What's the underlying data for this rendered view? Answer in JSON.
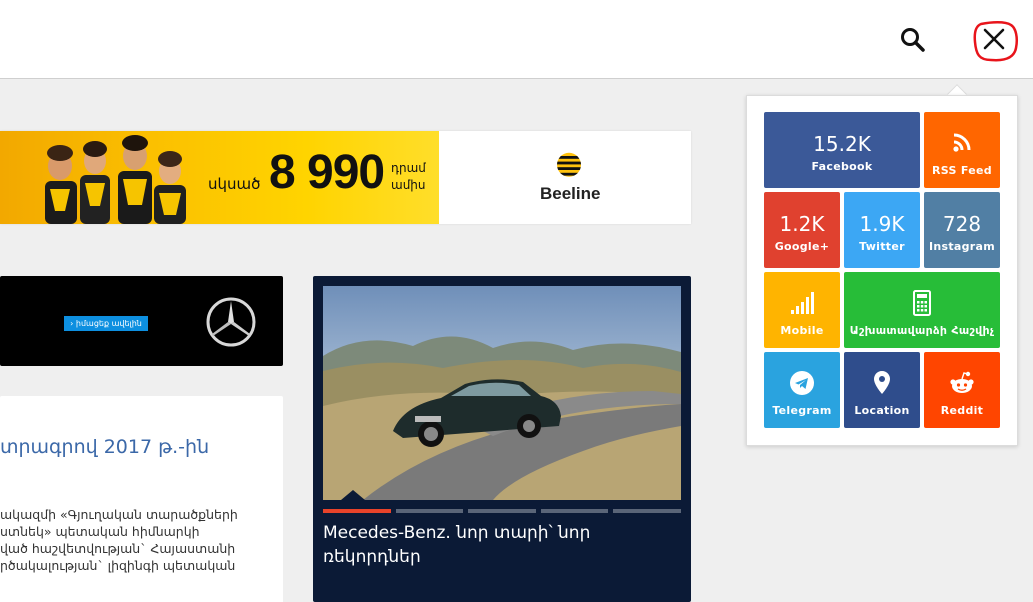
{
  "header": {
    "search_icon": "search-icon",
    "close_icon": "close-icon"
  },
  "beeline_ad": {
    "price_prefix": "սկսած",
    "price": "8 990",
    "unit_line1": "դրամ",
    "unit_line2": "ամիս",
    "brand": "Beeline",
    "colors": {
      "yellow": "#ffd400",
      "black": "#111111"
    }
  },
  "mercedes_ad": {
    "button_label": "› իմացեք ավելին",
    "logo_icon": "mercedes-star-icon"
  },
  "article": {
    "title": "տրագրով 2017 թ.-ին",
    "lines": [
      "ակազմի «Գյուղական տարածքների",
      "ստնեկ» պետական հիմնարկի",
      "ված հաշվետվության` Հայաստանի",
      "րծակալության` լիզինգի պետական"
    ]
  },
  "slider": {
    "title": "Mecedes-Benz. նոր տարի՝ նոր ռեկորդներ",
    "dots": 5,
    "active_index": 0,
    "colors": {
      "background": "#0b1a36",
      "active_dot": "#e8432a"
    }
  },
  "social": {
    "tiles": [
      {
        "id": "facebook",
        "count": "15.2K",
        "label": "Facebook",
        "color": "#3b5998"
      },
      {
        "id": "rss",
        "label": "RSS Feed",
        "color": "#ff6600",
        "icon": "rss-icon"
      },
      {
        "id": "googleplus",
        "count": "1.2K",
        "label": "Google+",
        "color": "#e0412f"
      },
      {
        "id": "twitter",
        "count": "1.9K",
        "label": "Twitter",
        "color": "#3ca7f4"
      },
      {
        "id": "instagram",
        "count": "728",
        "label": "Instagram",
        "color": "#517fa4"
      },
      {
        "id": "mobile",
        "label": "Mobile",
        "color": "#ffb400",
        "icon": "signal-bars-icon"
      },
      {
        "id": "calculator",
        "label": "Աշխատավարձի Հաշվիչ",
        "color": "#27bd38",
        "icon": "calculator-icon"
      },
      {
        "id": "telegram",
        "label": "Telegram",
        "color": "#2aa3df",
        "icon": "telegram-icon"
      },
      {
        "id": "location",
        "label": "Location",
        "color": "#2f4d8c",
        "icon": "location-pin-icon"
      },
      {
        "id": "reddit",
        "label": "Reddit",
        "color": "#ff4500",
        "icon": "reddit-icon"
      }
    ]
  }
}
